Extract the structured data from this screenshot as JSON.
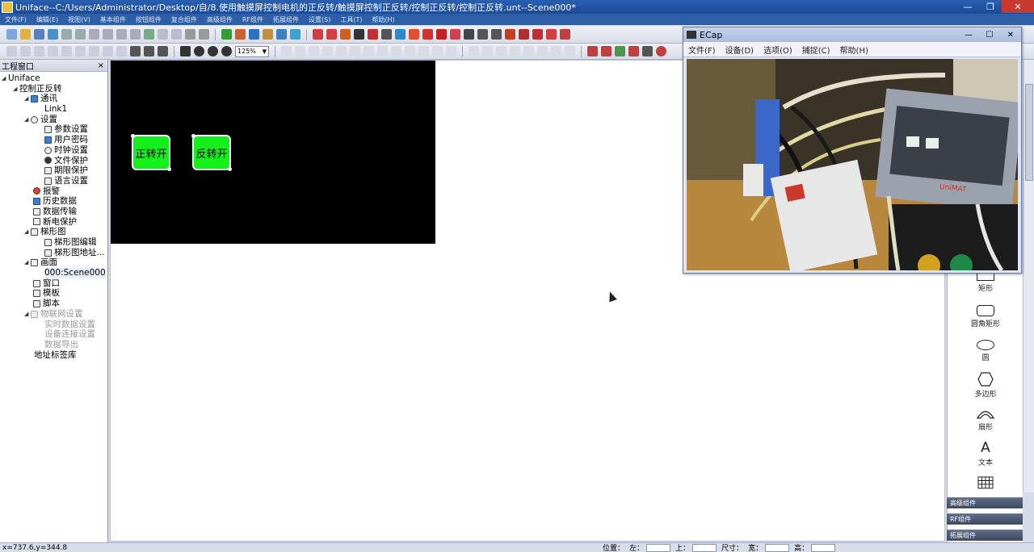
{
  "window": {
    "title": "Uniface--C:/Users/Administrator/Desktop/自/8.使用触摸屏控制电机的正反转/触摸屏控制正反转/控制正反转/控制正反转.unt--Scene000*"
  },
  "menubar": [
    "文件(F)",
    "编辑(E)",
    "视图(V)",
    "基本组件",
    "按钮组件",
    "复合组件",
    "高级组件",
    "RF组件",
    "拓展组件",
    "设置(S)",
    "工具(T)",
    "帮助(H)"
  ],
  "toolbar": {
    "zoom_value": "125%"
  },
  "project_panel": {
    "title": "工程窗口",
    "close": "×",
    "tree": {
      "root": "Uniface",
      "project": "控制正反转",
      "comm": "通讯",
      "link": "Link1",
      "settings": "设置",
      "param": "参数设置",
      "password": "用户密码",
      "clock": "时钟设置",
      "file_protect": "文件保护",
      "period": "期限保护",
      "language": "语言设置",
      "alarm": "报警",
      "history": "历史数据",
      "transfer": "数据传输",
      "power": "断电保护",
      "ladder": "梯形图",
      "ladder_edit": "梯形图编辑",
      "ladder_addr": "梯形图地址...",
      "screen": "画面",
      "scene": "000:Scene000",
      "window": "窗口",
      "template": "模板",
      "script": "脚本",
      "iot": "物联网设置",
      "realtime": "实时数据设置",
      "device": "设备连接设置",
      "export": "数据导出",
      "tags": "地址标签库"
    }
  },
  "scene": {
    "btn_forward": "正转开",
    "btn_reverse": "反转开"
  },
  "ecap": {
    "title": "ECap",
    "menu": [
      "文件(F)",
      "设备(D)",
      "选项(O)",
      "捕捉(C)",
      "帮助(H)"
    ],
    "device_brand": "UniMAT"
  },
  "palette": {
    "rect": "矩形",
    "round_rect": "圆角矩形",
    "circle": "圆",
    "polygon": "多边形",
    "sector": "扇形",
    "text": "文本",
    "text_glyph": "A",
    "groups": [
      "高级组件",
      "RF组件",
      "拓展组件"
    ]
  },
  "status": {
    "coords": "x=737.6,y=344.8",
    "position": "位置：",
    "left": "左：",
    "top": "上：",
    "size": "尺寸：",
    "width": "宽：",
    "height": "高："
  },
  "colors": {
    "title_blue": "#1c4a98",
    "button_green": "#13f01a",
    "scene_bg": "#000000"
  }
}
